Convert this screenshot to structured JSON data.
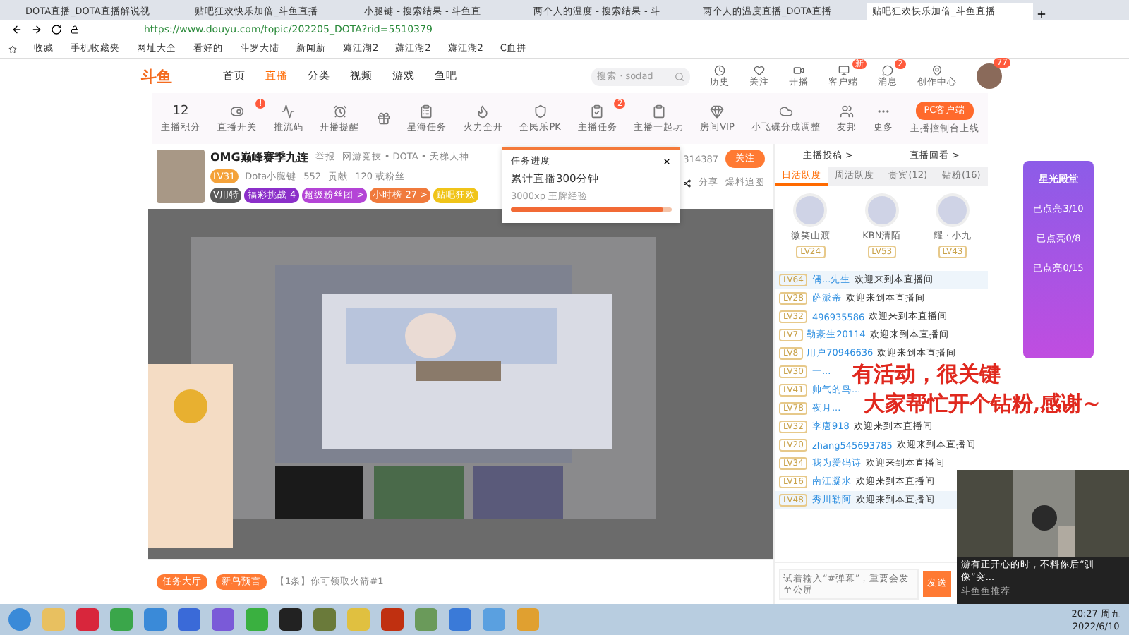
{
  "browser": {
    "tabs": [
      {
        "title": "DOTA直播_DOTA直播解说视",
        "selected": false
      },
      {
        "title": "贴吧狂欢快乐加倍_斗鱼直播",
        "selected": false
      },
      {
        "title": "小腿键 - 搜索结果 - 斗鱼直",
        "selected": false
      },
      {
        "title": "两个人的温度 - 搜索结果 - 斗",
        "selected": false
      },
      {
        "title": "两个人的温度直播_DOTA直播",
        "selected": false
      },
      {
        "title": "贴吧狂欢快乐加倍_斗鱼直播",
        "selected": true
      }
    ],
    "address": "https://www.douyu.com/topic/202205_DOTA?rid=5510379",
    "bookmarks": [
      "收藏",
      "手机收藏夹",
      "网址大全",
      "看好的",
      "斗罗大陆",
      "新闻新",
      "薅江湖2",
      "薅江湖2",
      "薅江湖2",
      "C血拼"
    ]
  },
  "site": {
    "logo": "斗鱼",
    "nav": [
      {
        "label": "首页",
        "selected": false
      },
      {
        "label": "直播",
        "selected": true
      },
      {
        "label": "分类",
        "selected": false
      },
      {
        "label": "视频",
        "selected": false
      },
      {
        "label": "游戏",
        "selected": false
      },
      {
        "label": "鱼吧",
        "selected": false
      }
    ],
    "search": {
      "placeholder": "搜索 · sodad"
    },
    "header_icons": [
      {
        "label": "历史"
      },
      {
        "label": "关注"
      },
      {
        "label": "开播"
      },
      {
        "label": "客户端",
        "badge": "新"
      },
      {
        "label": "消息",
        "badge": "2"
      },
      {
        "label": "创作中心"
      }
    ],
    "avatar_badge": "77"
  },
  "toolbar": {
    "score": "12",
    "score_label": "主播积分",
    "items": [
      {
        "label": "直播开关",
        "badge": "!"
      },
      {
        "label": "推流码"
      },
      {
        "label": "开播提醒"
      },
      {
        "label": "星海任务"
      },
      {
        "label": "火力全开"
      },
      {
        "label": "全民乐PK"
      },
      {
        "label": "主播任务",
        "badge": "2"
      },
      {
        "label": "主播一起玩"
      },
      {
        "label": "房间VIP"
      },
      {
        "label": "小飞碟分成调整"
      },
      {
        "label": "友邦"
      },
      {
        "label": "更多"
      }
    ],
    "client_button": "PC客户端",
    "client_note": "主播控制台上线"
  },
  "stream": {
    "title": "OMG巅峰赛季九连",
    "report": "举报",
    "category": "网游竞技 • DOTA • 天梯大神",
    "level": "LV31",
    "streamer": "Dota小腿键",
    "heat": "552",
    "contribution": "贡献",
    "fans": "120 或粉丝",
    "room_id": "314387",
    "follow": "关注",
    "badges": [
      {
        "label": "V用特",
        "color": "#5a5a5a"
      },
      {
        "label": "福彩挑战 4",
        "color": "#8b2fc9"
      },
      {
        "label": "超级粉丝团 >",
        "color": "#b444d6"
      },
      {
        "label": "小时榜 27 >",
        "color": "#f07a3c"
      },
      {
        "label": "贴吧狂欢",
        "color": "#f0c419"
      }
    ],
    "share": "分享",
    "clip": "爆料追图"
  },
  "task_popup": {
    "title": "任务进度",
    "task": "累计直播300分钟",
    "reward": "3000xp 王牌经验",
    "level": 0.95
  },
  "chat": {
    "links": [
      "主播投稿 >",
      "直播回看 >"
    ],
    "tabs": [
      {
        "label": "日活跃度",
        "selected": true
      },
      {
        "label": "周活跃度",
        "selected": false
      },
      {
        "label": "贵宾(12)",
        "selected": false
      },
      {
        "label": "钻粉(16)",
        "selected": false
      }
    ],
    "top": [
      {
        "name": "微笑山渡",
        "level": "LV24"
      },
      {
        "name": "KBN清陌",
        "level": "LV53"
      },
      {
        "name": "耀 · 小九",
        "level": "LV43"
      }
    ],
    "messages": [
      {
        "level": "LV64",
        "name": "偶...先生",
        "text": "欢迎来到本直播间",
        "highlight": true
      },
      {
        "level": "LV28",
        "name": "萨派蒂",
        "text": "欢迎来到本直播间",
        "highlight": false
      },
      {
        "level": "LV32",
        "name": "496935586",
        "text": "欢迎来到本直播间",
        "highlight": false
      },
      {
        "level": "LV7",
        "name": "勒豪生20114",
        "text": "欢迎来到本直播间",
        "highlight": false
      },
      {
        "level": "LV8",
        "name": "用户70946636",
        "text": "欢迎来到本直播间",
        "highlight": false
      },
      {
        "level": "LV30",
        "name": "一...",
        "highlight": false
      },
      {
        "level": "LV41",
        "name": "帅气的鸟...",
        "highlight": false
      },
      {
        "level": "LV78",
        "name": "夜月...",
        "highlight": false
      },
      {
        "level": "LV32",
        "name": "李唐918",
        "text": "欢迎来到本直播间",
        "highlight": false
      },
      {
        "level": "LV20",
        "name": "zhang545693785",
        "text": "欢迎来到本直播间",
        "highlight": false
      },
      {
        "level": "LV34",
        "name": "我为爱码诗",
        "text": "欢迎来到本直播间",
        "highlight": false
      },
      {
        "level": "LV16",
        "name": "南江凝水",
        "text": "欢迎来到本直播间",
        "highlight": false
      },
      {
        "level": "LV48",
        "name": "秀川勒阿",
        "text": "欢迎来到本直播间",
        "highlight": true
      }
    ],
    "input": {
      "placeholder": "试着输入“#弹幕”，重要会发至公屏"
    },
    "send": "发送"
  },
  "promo": {
    "title": "星光殿堂",
    "items": [
      "已点亮3/10",
      "已点亮0/8",
      "已点亮0/15"
    ]
  },
  "overlay": [
    "有活动，很关键",
    "大家帮忙开个钻粉,感谢~"
  ],
  "pip": {
    "caption": "游有正开心的时，不料你后“驯像”突...",
    "source": "斗鱼鱼推荐"
  },
  "giftbar": {
    "tiles": [
      "任务大厅",
      "新鸟预言"
    ],
    "notice": "【1条】你可领取火箭#1"
  },
  "taskbar": {
    "clock": "20:27 周五",
    "date": "2022/6/10"
  }
}
